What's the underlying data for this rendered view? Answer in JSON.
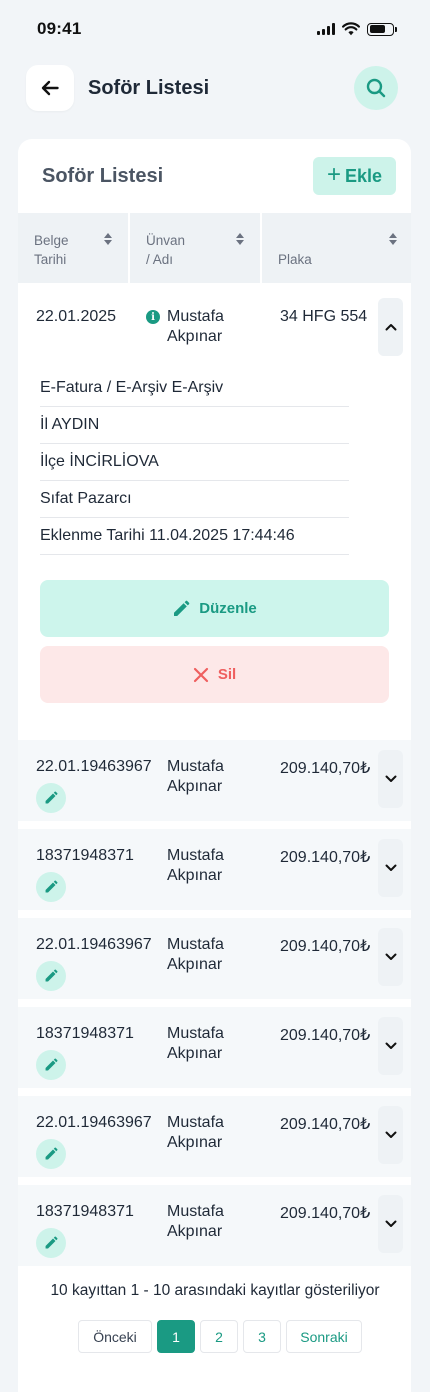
{
  "status_bar": {
    "time": "09:41"
  },
  "header": {
    "title": "Soför Listesi"
  },
  "card": {
    "title": "Soför Listesi",
    "add_label": "Ekle",
    "columns": [
      {
        "line1": "Belge",
        "line2": "Tarihi"
      },
      {
        "line1": "Ünvan",
        "line2": "/ Adı"
      },
      {
        "line1": "",
        "line2": "Plaka"
      }
    ]
  },
  "expanded_row": {
    "date": "22.01.2025",
    "name_line1": "Mustafa",
    "name_line2": "Akpınar",
    "plate": "34 HFG 554",
    "info_icon": "i",
    "details": [
      "E-Fatura / E-Arşiv E-Arşiv",
      "İl AYDIN",
      "İlçe İNCİRLİOVA",
      "Sıfat Pazarcı",
      "Eklenme Tarihi 11.04.2025 17:44:46"
    ],
    "edit_label": "Düzenle",
    "delete_label": "Sil"
  },
  "rows": [
    {
      "date": "22.01.19463967",
      "name_line1": "Mustafa",
      "name_line2": "Akpınar",
      "amount": "209.140,70₺"
    },
    {
      "date": "18371948371",
      "name_line1": "Mustafa",
      "name_line2": "Akpınar",
      "amount": "209.140,70₺"
    },
    {
      "date": "22.01.19463967",
      "name_line1": "Mustafa",
      "name_line2": "Akpınar",
      "amount": "209.140,70₺"
    },
    {
      "date": "18371948371",
      "name_line1": "Mustafa",
      "name_line2": "Akpınar",
      "amount": "209.140,70₺"
    },
    {
      "date": "22.01.19463967",
      "name_line1": "Mustafa",
      "name_line2": "Akpınar",
      "amount": "209.140,70₺"
    },
    {
      "date": "18371948371",
      "name_line1": "Mustafa",
      "name_line2": "Akpınar",
      "amount": "209.140,70₺"
    }
  ],
  "footer": {
    "summary": "10 kayıttan 1 - 10 arasındaki kayıtlar gösteriliyor",
    "prev_label": "Önceki",
    "pages": [
      "1",
      "2",
      "3"
    ],
    "current_page": "1",
    "next_label": "Sonraki"
  },
  "colors": {
    "accent": "#1a9a83",
    "accent_light": "#cdf3ea",
    "danger": "#ef5f5f",
    "danger_light": "#fde8e8",
    "background": "#f2f5f8"
  },
  "icons": {
    "back": "arrow-left-icon",
    "search": "search-icon",
    "add": "plus-icon",
    "sort": "sort-icon",
    "info": "info-icon",
    "collapse": "chevron-up-icon",
    "expand": "chevron-down-icon",
    "edit": "pencil-icon",
    "delete": "close-icon"
  }
}
